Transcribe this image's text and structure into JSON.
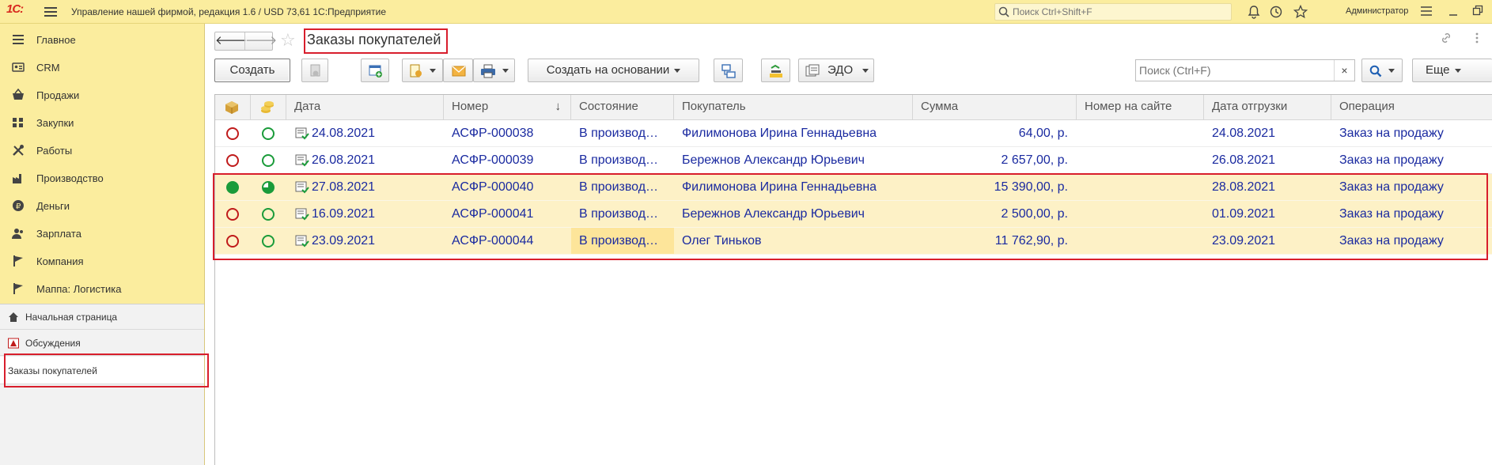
{
  "app": {
    "logo": "1С:",
    "title": "Управление нашей фирмой, редакция 1.6 / USD 73,61 1С:Предприятие",
    "search_placeholder": "Поиск Ctrl+Shift+F",
    "user": "Администратор"
  },
  "sidebar": {
    "sections": [
      {
        "label": "Главное",
        "icon": "menu-list-icon"
      },
      {
        "label": "CRM",
        "icon": "crm-card-icon"
      },
      {
        "label": "Продажи",
        "icon": "basket-icon"
      },
      {
        "label": "Закупки",
        "icon": "purchases-icon"
      },
      {
        "label": "Работы",
        "icon": "tools-icon"
      },
      {
        "label": "Производство",
        "icon": "factory-icon"
      },
      {
        "label": "Деньги",
        "icon": "money-coin-icon"
      },
      {
        "label": "Зарплата",
        "icon": "people-icon"
      },
      {
        "label": "Компания",
        "icon": "flag-icon"
      },
      {
        "label": "Маппа: Логистика",
        "icon": "flag-icon"
      }
    ],
    "lower": [
      {
        "label": "Начальная страница",
        "icon": "home-icon"
      },
      {
        "label": "Обсуждения",
        "icon": "discussions-icon"
      },
      {
        "label": "Заказы покупателей",
        "active": true
      }
    ]
  },
  "main": {
    "title": "Заказы покупателей",
    "toolbar": {
      "create": "Создать",
      "create_based": "Создать на основании",
      "edo": "ЭДО",
      "search_placeholder": "Поиск (Ctrl+F)",
      "clear": "×",
      "more": "Еще"
    },
    "columns": [
      "Дата",
      "Номер",
      "Состояние",
      "Покупатель",
      "Сумма",
      "Номер на сайте",
      "Дата отгрузки",
      "Операция"
    ],
    "sort_indicator": "↓",
    "rows": [
      {
        "status1": "open-red",
        "status2": "open-green",
        "date": "24.08.2021",
        "number": "АСФР-000038",
        "state": "В производ…",
        "customer": "Филимонова Ирина Геннадьевна",
        "sum": "64,00, р.",
        "site_no": "",
        "ship_date": "24.08.2021",
        "operation": "Заказ на продажу",
        "highlight": false
      },
      {
        "status1": "open-red",
        "status2": "open-green",
        "date": "26.08.2021",
        "number": "АСФР-000039",
        "state": "В производ…",
        "customer": "Бережнов Александр Юрьевич",
        "sum": "2 657,00, р.",
        "site_no": "",
        "ship_date": "26.08.2021",
        "operation": "Заказ на продажу",
        "highlight": false
      },
      {
        "status1": "filled-green",
        "status2": "partial-green",
        "date": "27.08.2021",
        "number": "АСФР-000040",
        "state": "В производ…",
        "customer": "Филимонова Ирина Геннадьевна",
        "sum": "15 390,00, р.",
        "site_no": "",
        "ship_date": "28.08.2021",
        "operation": "Заказ на продажу",
        "highlight": true
      },
      {
        "status1": "open-red",
        "status2": "open-green",
        "date": "16.09.2021",
        "number": "АСФР-000041",
        "state": "В производ…",
        "customer": "Бережнов Александр Юрьевич",
        "sum": "2 500,00, р.",
        "site_no": "",
        "ship_date": "01.09.2021",
        "operation": "Заказ на продажу",
        "highlight": true
      },
      {
        "status1": "open-red",
        "status2": "open-green",
        "date": "23.09.2021",
        "number": "АСФР-000044",
        "state": "В производ…",
        "customer": "Олег Тиньков",
        "sum": "11 762,90, р.",
        "site_no": "",
        "ship_date": "23.09.2021",
        "operation": "Заказ на продажу",
        "highlight": true,
        "current_cell": "state"
      }
    ]
  },
  "colors": {
    "header_bg": "#fbed9e",
    "highlight_row": "#fdf1c6",
    "link_text": "#1a2aa0",
    "annotation_red": "#d81e2c"
  }
}
